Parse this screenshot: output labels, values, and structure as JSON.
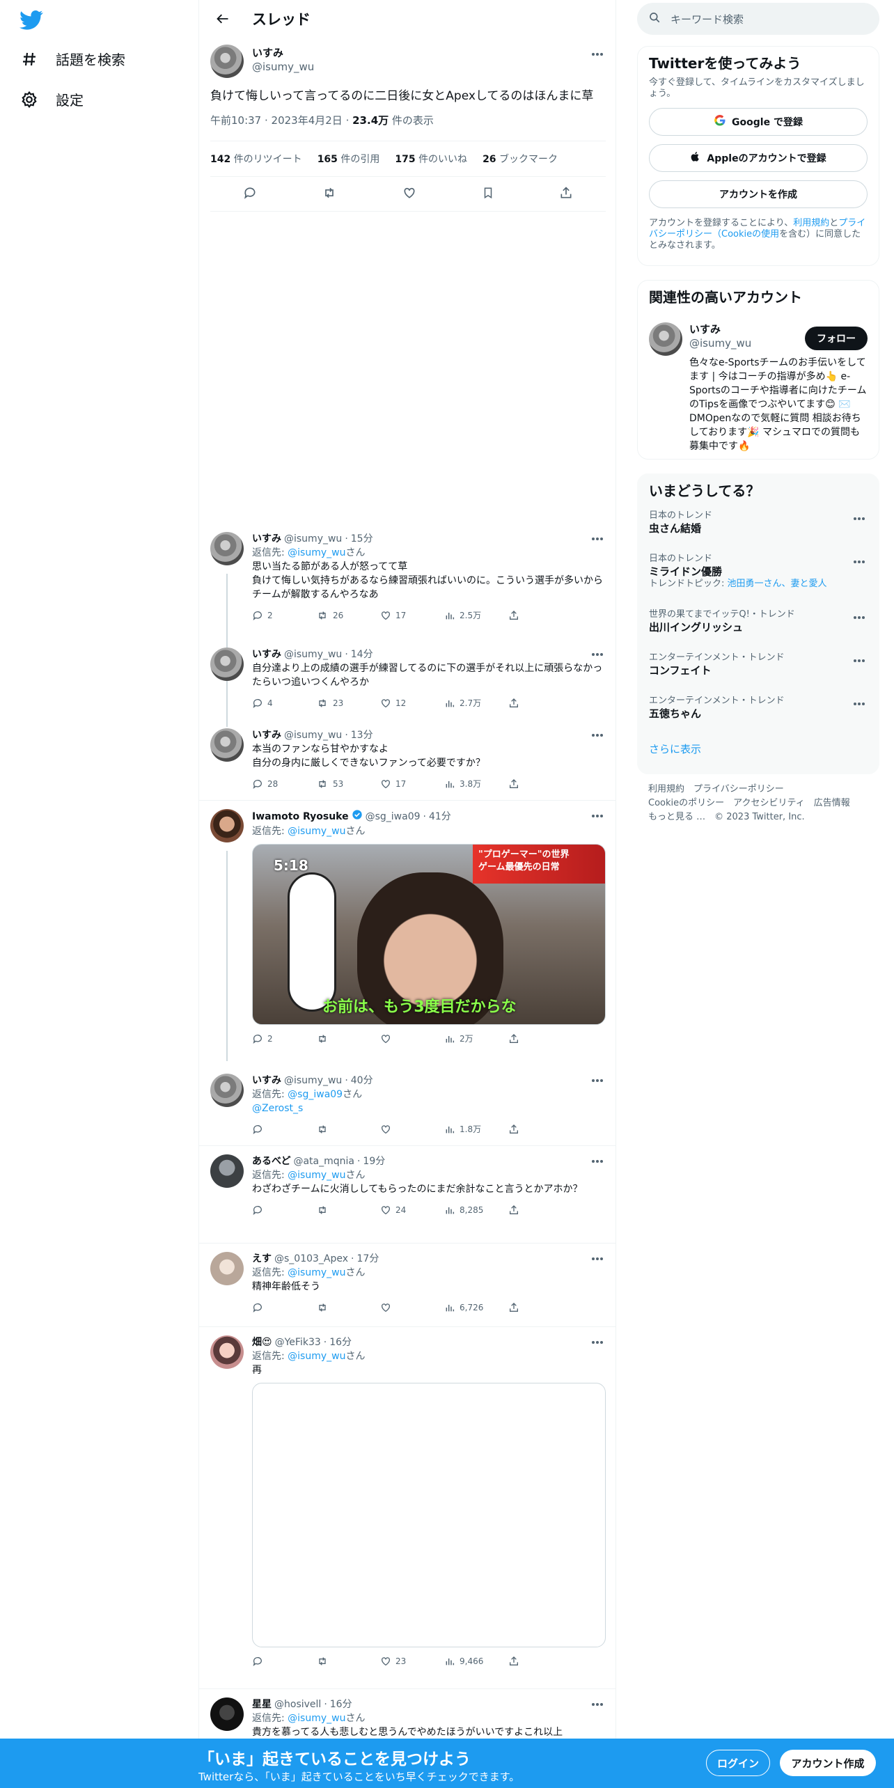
{
  "nav": {
    "items": [
      {
        "label": "話題を検索",
        "icon": "hashtag-icon"
      },
      {
        "label": "設定",
        "icon": "gear-icon"
      }
    ]
  },
  "header": {
    "title": "スレッド"
  },
  "focus": {
    "name": "いすみ",
    "handle": "@isumy_wu",
    "text": "負けて悔しいって言ってるのに二日後に女とApexしてるのはほんまに草",
    "time": "午前10:37",
    "date": "2023年4月2日",
    "views_num": "23.4万",
    "views_label": "件の表示",
    "retweets_num": "142",
    "retweets_label": "件のリツイート",
    "quotes_num": "165",
    "quotes_label": "件の引用",
    "likes_num": "175",
    "likes_label": "件のいいね",
    "bookmarks_num": "26",
    "bookmarks_label": "ブックマーク"
  },
  "replies": [
    {
      "name": "いすみ",
      "handle": "@isumy_wu",
      "time": "15分",
      "reply_prefix": "返信先:",
      "reply_to": "@isumy_wu",
      "reply_suffix": "さん",
      "text": "思い当たる節がある人が怒ってて草\n負けて悔しい気持ちがあるなら練習頑張ればいいのに。こういう選手が多いからチームが解散するんやろなあ",
      "replies": "2",
      "retweets": "26",
      "likes": "17",
      "views": "2.5万"
    },
    {
      "name": "いすみ",
      "handle": "@isumy_wu",
      "time": "14分",
      "text": "自分達より上の成績の選手が練習してるのに下の選手がそれ以上に頑張らなかったらいつ追いつくんやろか",
      "replies": "4",
      "retweets": "23",
      "likes": "12",
      "views": "2.7万"
    },
    {
      "name": "いすみ",
      "handle": "@isumy_wu",
      "time": "13分",
      "text": "本当のファンなら甘やかすなよ\n自分の身内に厳しくできないファンって必要ですか？",
      "replies": "28",
      "retweets": "53",
      "likes": "17",
      "views": "3.8万"
    },
    {
      "name": "Iwamoto Ryosuke",
      "handle": "@sg_iwa09",
      "time": "41分",
      "reply_prefix": "返信先:",
      "reply_to": "@isumy_wu",
      "reply_suffix": "さん",
      "replies": "2",
      "retweets": "",
      "likes": "",
      "views": "2万",
      "media_text": {
        "tv": "5:18",
        "tag1": "\"プロゲーマー\"の世界",
        "tag2": "ゲーム最優先の日常",
        "caption": "お前は、もう3度目だからな"
      }
    },
    {
      "name": "いすみ",
      "handle": "@isumy_wu",
      "time": "40分",
      "reply_prefix": "返信先:",
      "reply_to": "@sg_iwa09",
      "reply_suffix": "さん",
      "mention": "@Zerost_s",
      "replies": "",
      "retweets": "",
      "likes": "",
      "views": "1.8万"
    },
    {
      "name": "あるべど",
      "handle": "@ata_mqnia",
      "time": "19分",
      "reply_prefix": "返信先:",
      "reply_to": "@isumy_wu",
      "reply_suffix": "さん",
      "text": "わざわざチームに火消ししてもらったのにまだ余計なこと言うとかアホか？",
      "replies": "",
      "retweets": "",
      "likes": "24",
      "views": "8,285"
    },
    {
      "name": "えす",
      "handle": "@s_0103_Apex",
      "time": "17分",
      "reply_prefix": "返信先:",
      "reply_to": "@isumy_wu",
      "reply_suffix": "さん",
      "text": "精神年齢低そう",
      "replies": "",
      "retweets": "",
      "likes": "",
      "views": "6,726"
    },
    {
      "name": "畑😍",
      "handle": "@YeFik33",
      "time": "16分",
      "reply_prefix": "返信先:",
      "reply_to": "@isumy_wu",
      "reply_suffix": "さん",
      "text": "再",
      "replies": "",
      "retweets": "",
      "likes": "23",
      "views": "9,466"
    },
    {
      "name": "星星",
      "handle": "@hosivell",
      "time": "16分",
      "reply_prefix": "返信先:",
      "reply_to": "@isumy_wu",
      "reply_suffix": "さん",
      "text": "貴方を慕ってる人も悲しむと思うんでやめたほうがいいですよこれ以上"
    }
  ],
  "right": {
    "search_placeholder": "キーワード検索",
    "signup": {
      "title": "Twitterを使ってみよう",
      "sub": "今すぐ登録して、タイムラインをカスタマイズしましょう。",
      "google": "Google で登録",
      "apple": "Appleのアカウントで登録",
      "create": "アカウントを作成",
      "legal_pre": "アカウントを登録することにより、",
      "legal_terms": "利用規約",
      "legal_and": "と",
      "legal_privacy": "プライバシーポリシー（Cookieの使用",
      "legal_post": "を含む）に同意したとみなされます。"
    },
    "related": {
      "title": "関連性の高いアカウント",
      "name": "いすみ",
      "handle": "@isumy_wu",
      "follow": "フォロー",
      "bio": "色々なe-Sportsチームのお手伝いをしてます | 今はコーチの指導が多め👆 e-Sportsのコーチや指導者に向けたチームのTipsを画像でつぶやいてます😊 ✉️DMOpenなので気軽に質問 相談お待ちしております🎉 マシュマロでの質問も募集中です🔥"
    },
    "trends": {
      "title": "いまどうしてる？",
      "items": [
        {
          "cat": "日本のトレンド",
          "name": "虫さん結婚",
          "extra": ""
        },
        {
          "cat": "日本のトレンド",
          "name": "ミライドン優勝",
          "extra_pre": "トレンドトピック: ",
          "extra_link": "池田勇一さん、妻と愛人"
        },
        {
          "cat": "世界の果てまでイッテQ!・トレンド",
          "name": "出川イングリッシュ",
          "extra": ""
        },
        {
          "cat": "エンターテインメント・トレンド",
          "name": "コンフェイト",
          "extra": ""
        },
        {
          "cat": "エンターテインメント・トレンド",
          "name": "五徳ちゃん",
          "extra": ""
        }
      ],
      "show_more": "さらに表示"
    },
    "footer": {
      "line1": "利用規約　プライバシーポリシー",
      "line2": "Cookieのポリシー　アクセシビリティ　広告情報",
      "line3": "もっと見る …　© 2023 Twitter, Inc."
    }
  },
  "bottom": {
    "title": "「いま」起きていることを見つけよう",
    "sub": "Twitterなら、「いま」起きていることをいち早くチェックできます。",
    "login": "ログイン",
    "signup": "アカウント作成"
  }
}
